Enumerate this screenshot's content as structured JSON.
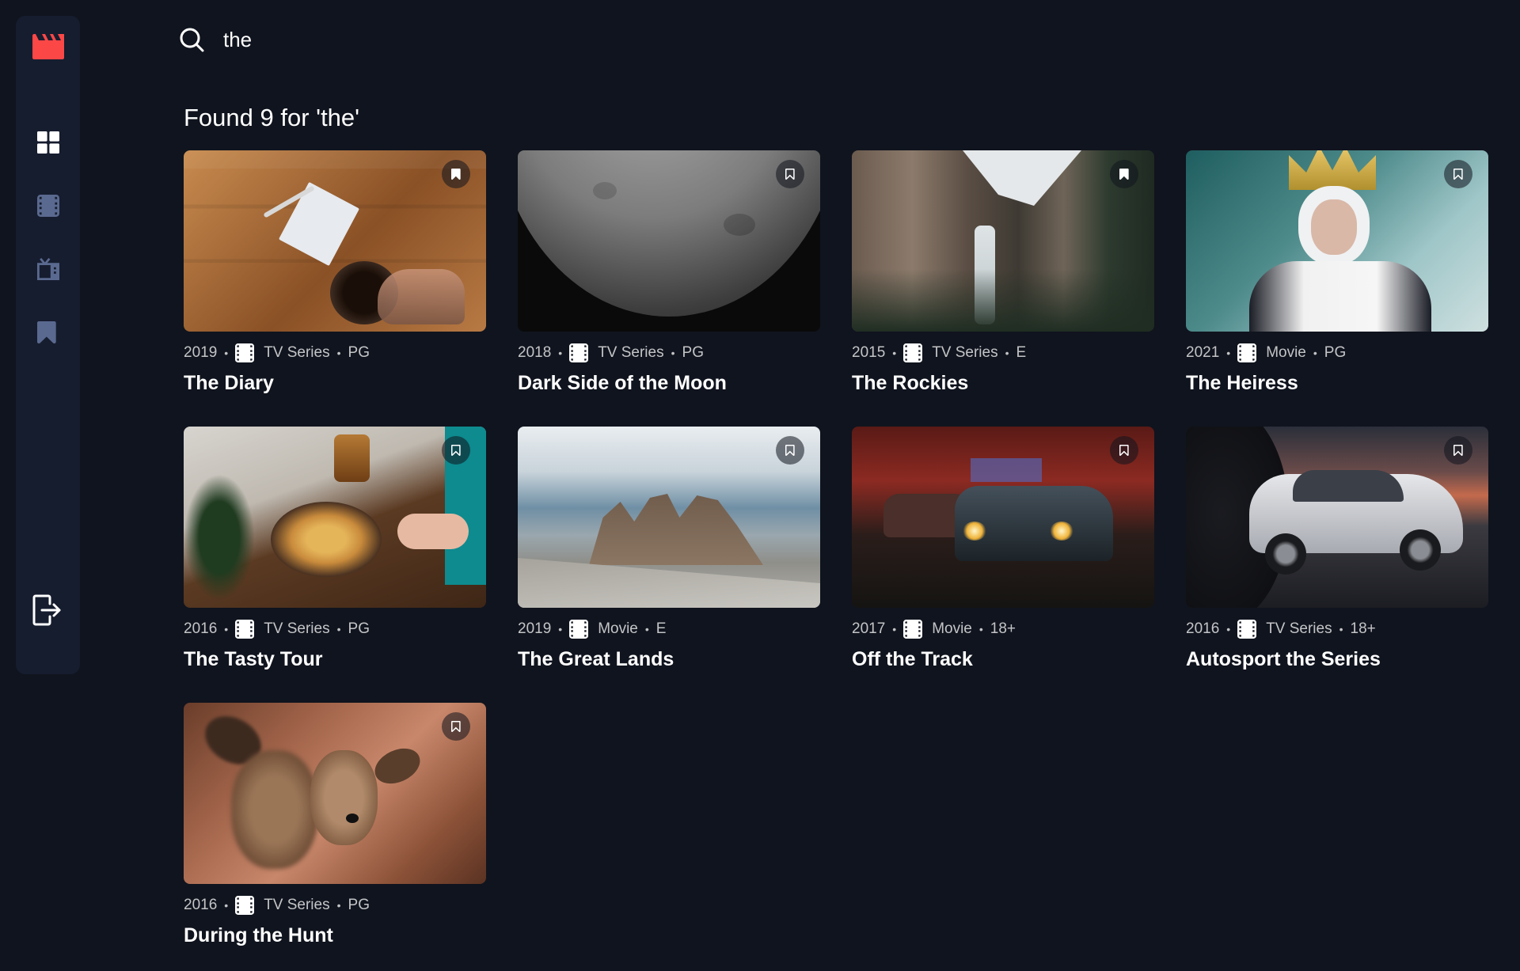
{
  "app": {
    "logo": "clapperboard-icon"
  },
  "sidebar": {
    "nav": [
      {
        "name": "home",
        "icon": "grid-icon",
        "active": true
      },
      {
        "name": "movies",
        "icon": "film-icon"
      },
      {
        "name": "tv-series",
        "icon": "tv-icon"
      },
      {
        "name": "bookmarks",
        "icon": "bookmark-icon"
      }
    ],
    "logout_icon": "logout-icon"
  },
  "search": {
    "value": "the",
    "icon": "search-icon"
  },
  "results": {
    "heading": "Found 9 for 'the'",
    "items": [
      {
        "year": "2019",
        "category": "TV Series",
        "rating": "PG",
        "title": "The Diary",
        "bookmarked": true
      },
      {
        "year": "2018",
        "category": "TV Series",
        "rating": "PG",
        "title": "Dark Side of the Moon",
        "bookmarked": false
      },
      {
        "year": "2015",
        "category": "TV Series",
        "rating": "E",
        "title": "The Rockies",
        "bookmarked": true
      },
      {
        "year": "2021",
        "category": "Movie",
        "rating": "PG",
        "title": "The Heiress",
        "bookmarked": false
      },
      {
        "year": "2016",
        "category": "TV Series",
        "rating": "PG",
        "title": "The Tasty Tour",
        "bookmarked": false
      },
      {
        "year": "2019",
        "category": "Movie",
        "rating": "E",
        "title": "The Great Lands",
        "bookmarked": false
      },
      {
        "year": "2017",
        "category": "Movie",
        "rating": "18+",
        "title": "Off the Track",
        "bookmarked": false
      },
      {
        "year": "2016",
        "category": "TV Series",
        "rating": "18+",
        "title": "Autosport the Series",
        "bookmarked": false
      },
      {
        "year": "2016",
        "category": "TV Series",
        "rating": "PG",
        "title": "During the Hunt",
        "bookmarked": false
      }
    ]
  },
  "colors": {
    "background": "#10141e",
    "sidebar": "#161d2f",
    "accent": "#fc4747",
    "icon": "#5a698f"
  }
}
